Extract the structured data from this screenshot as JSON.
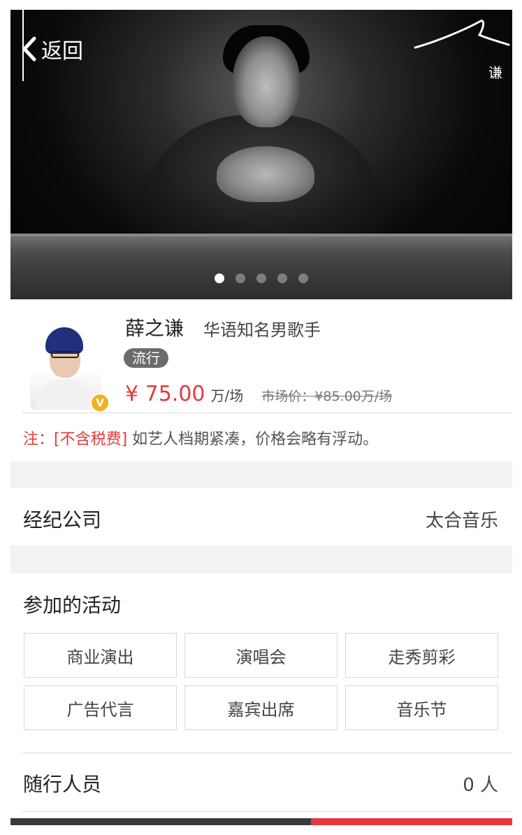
{
  "header": {
    "back_label": "返回",
    "signature_caption": "谦",
    "carousel_total": 5,
    "carousel_active": 1
  },
  "artist": {
    "name": "薛之谦",
    "title": "华语知名男歌手",
    "genre_tag": "流行",
    "price": "¥ 75.00",
    "price_unit": "万/场",
    "market_price": "市场价：¥85.00万/场"
  },
  "note": {
    "prefix": "注：[不含税费]",
    "text": " 如艺人档期紧凑，价格会略有浮动。"
  },
  "agency": {
    "label": "经纪公司",
    "value": "太合音乐"
  },
  "activities": {
    "title": "参加的活动",
    "items": [
      "商业演出",
      "演唱会",
      "走秀剪彩",
      "广告代言",
      "嘉宾出席",
      "音乐节"
    ]
  },
  "entourage": {
    "label": "随行人员",
    "value": "0 人"
  },
  "colors": {
    "accent_red": "#e63a3a",
    "tag_bg": "#6b6b6b",
    "badge": "#f0b223"
  }
}
